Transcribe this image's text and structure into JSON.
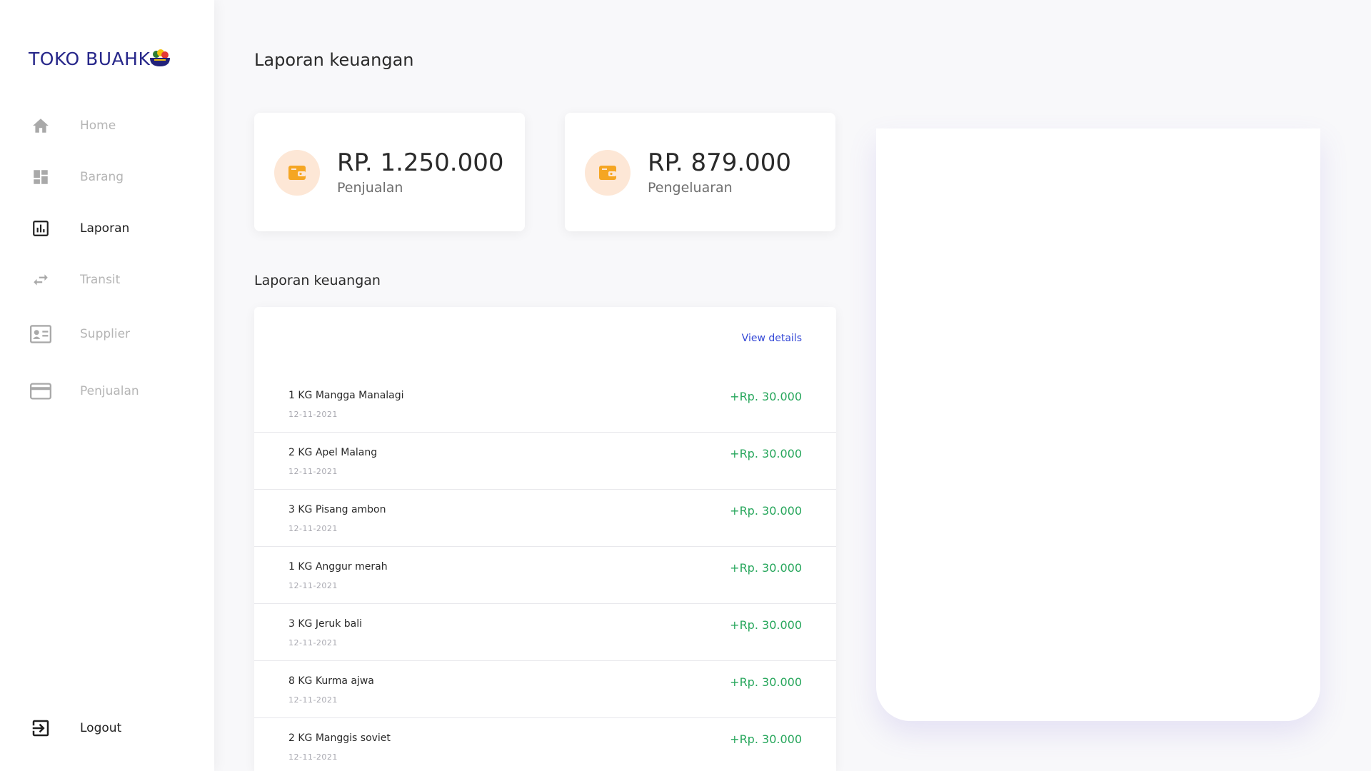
{
  "app": {
    "logo_text": "TOKO BUAHK"
  },
  "sidebar": {
    "items": [
      {
        "label": "Home",
        "icon": "home-icon",
        "active": false
      },
      {
        "label": "Barang",
        "icon": "dashboard-grid-icon",
        "active": false
      },
      {
        "label": "Laporan",
        "icon": "bar-chart-icon",
        "active": true
      },
      {
        "label": "Transit",
        "icon": "swap-arrows-icon",
        "active": false
      },
      {
        "label": "Supplier",
        "icon": "contact-card-icon",
        "active": false
      },
      {
        "label": "Penjualan",
        "icon": "credit-card-icon",
        "active": false
      }
    ],
    "logout_label": "Logout"
  },
  "main": {
    "page_title": "Laporan keuangan",
    "stats": [
      {
        "value": "RP. 1.250.000",
        "label": "Penjualan",
        "icon": "wallet-icon"
      },
      {
        "value": "RP. 879.000",
        "label": "Pengeluaran",
        "icon": "wallet-icon"
      }
    ],
    "section_title": "Laporan keuangan",
    "view_details_label": "View details",
    "transactions": [
      {
        "name": "1 KG Mangga Manalagi",
        "date": "12-11-2021",
        "amount": "+Rp. 30.000"
      },
      {
        "name": "2 KG Apel Malang",
        "date": "12-11-2021",
        "amount": "+Rp. 30.000"
      },
      {
        "name": "3 KG Pisang ambon",
        "date": "12-11-2021",
        "amount": "+Rp. 30.000"
      },
      {
        "name": "1 KG Anggur merah",
        "date": "12-11-2021",
        "amount": "+Rp. 30.000"
      },
      {
        "name": "3 KG Jeruk bali",
        "date": "12-11-2021",
        "amount": "+Rp. 30.000"
      },
      {
        "name": "8 KG Kurma ajwa",
        "date": "12-11-2021",
        "amount": "+Rp. 30.000"
      },
      {
        "name": "2 KG Manggis soviet",
        "date": "12-11-2021",
        "amount": "+Rp. 30.000"
      }
    ]
  },
  "colors": {
    "accent": "#3347d6",
    "positive": "#26a65b",
    "brand": "#27278a",
    "icon_orange": "#f5a623",
    "icon_bg": "#fde7d6"
  }
}
